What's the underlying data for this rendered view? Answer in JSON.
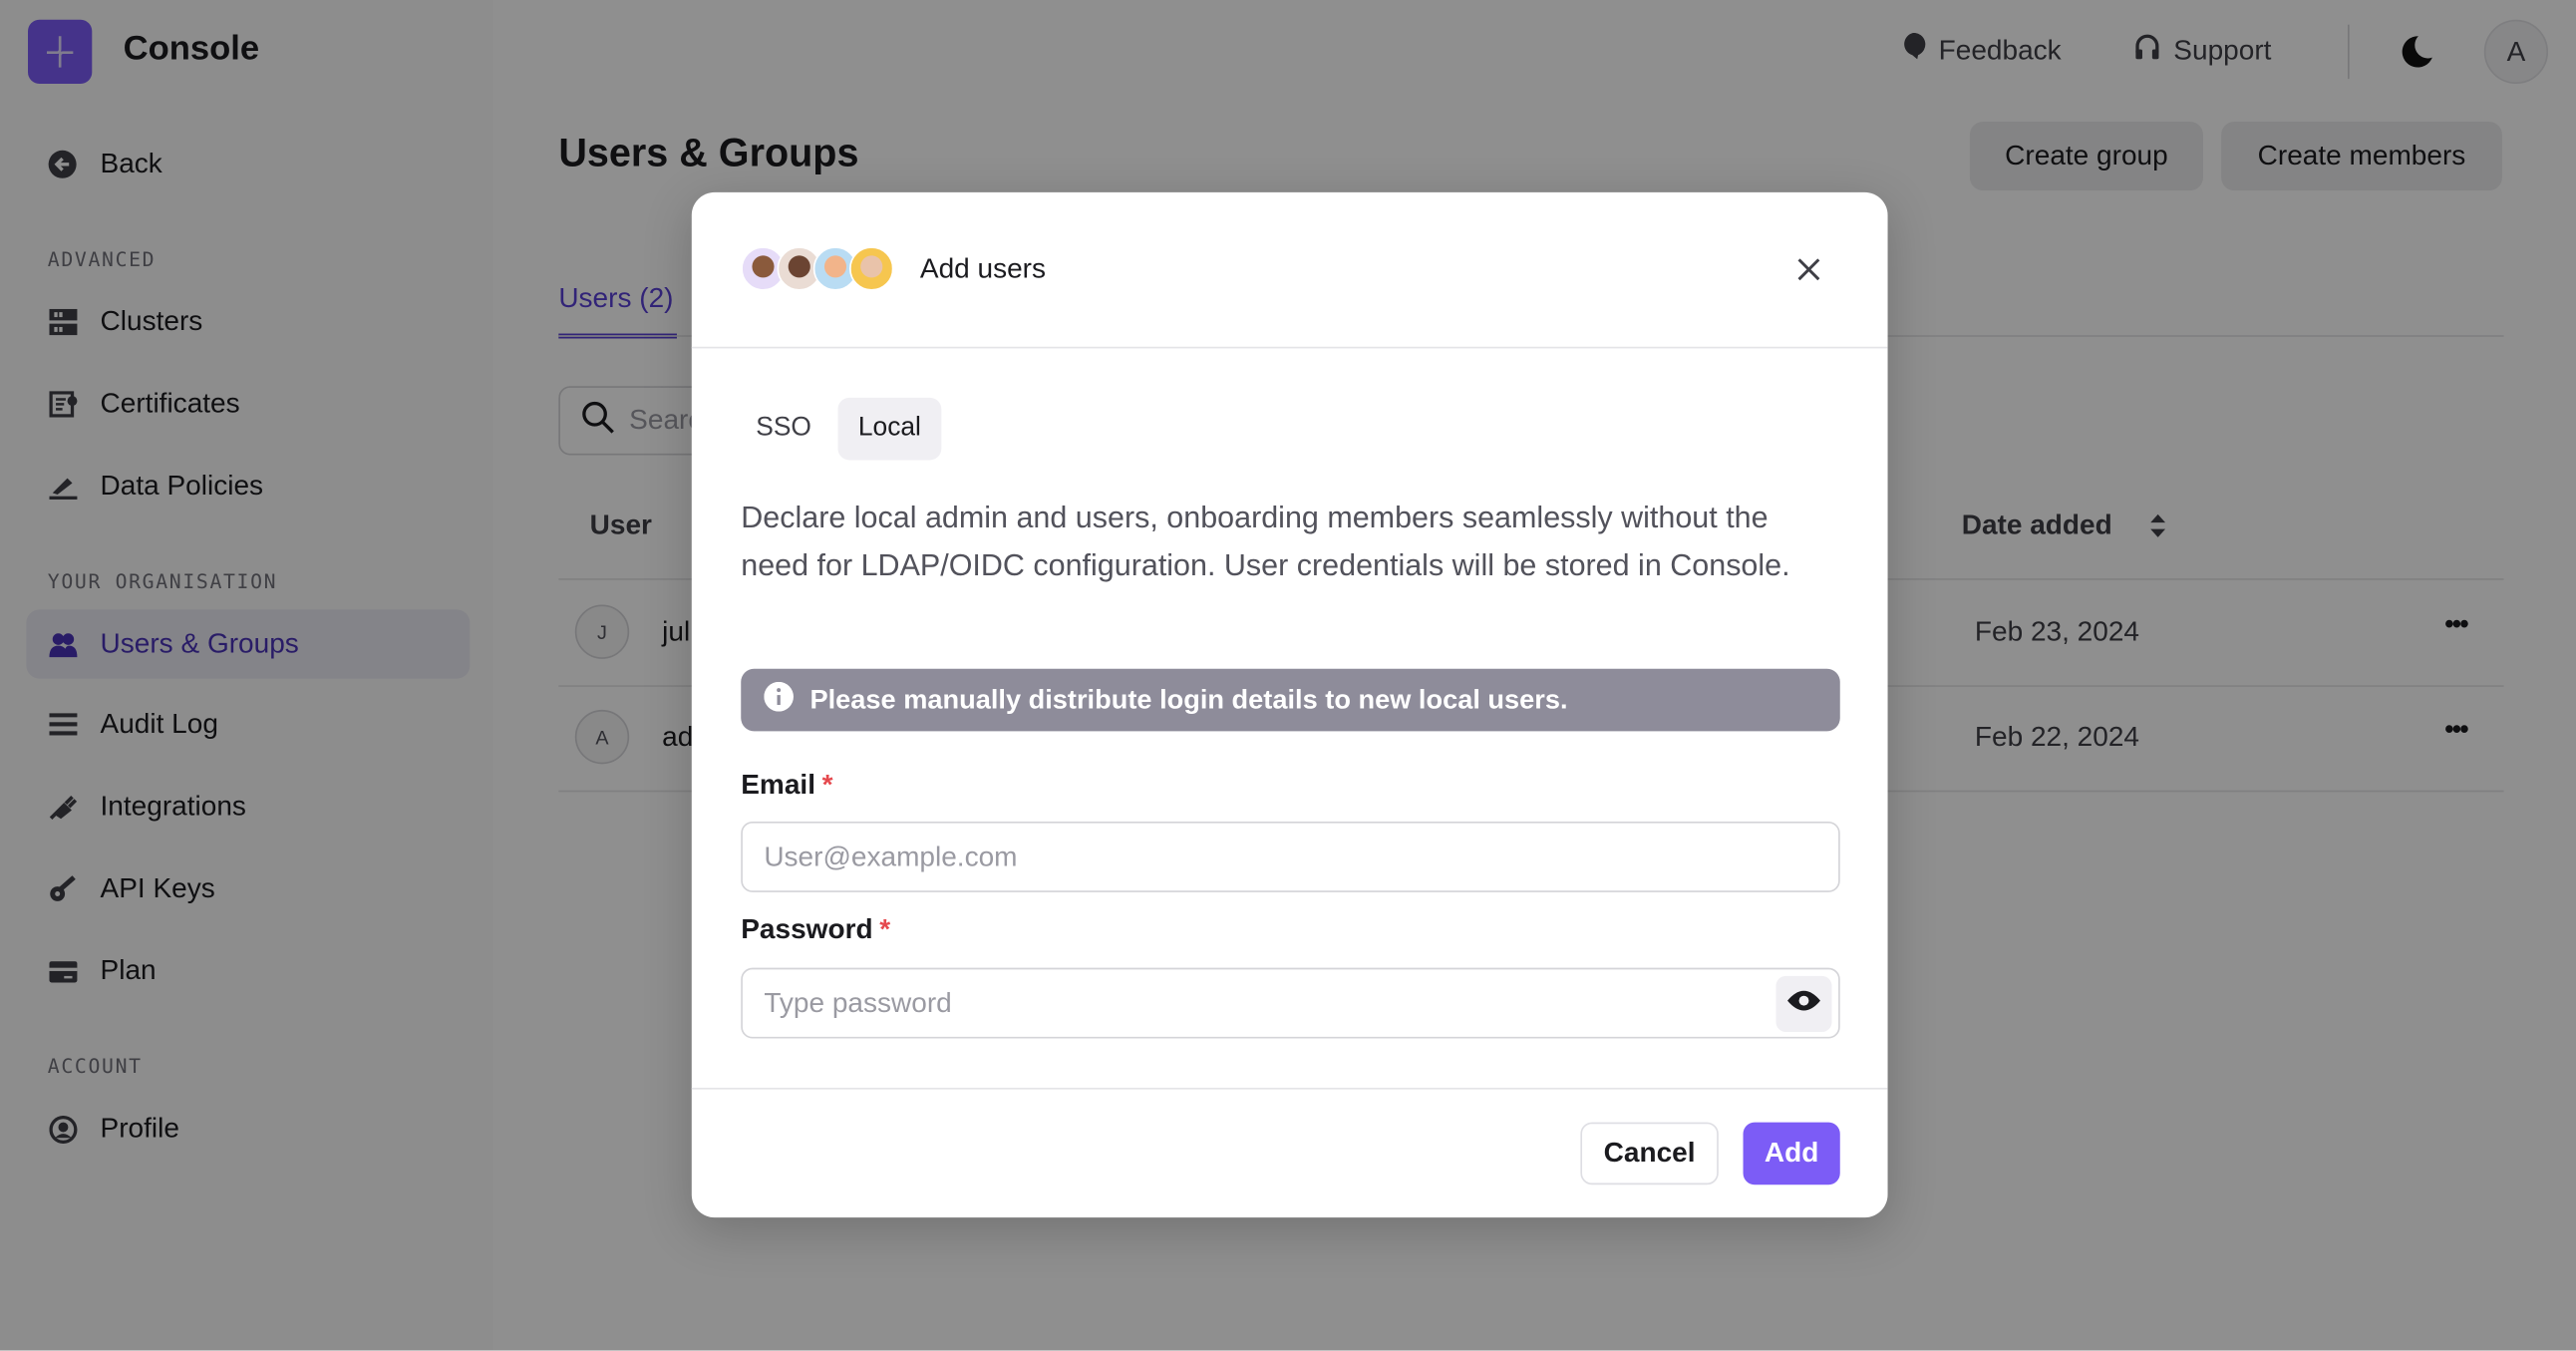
{
  "app": {
    "title": "Console"
  },
  "header": {
    "feedback": "Feedback",
    "support": "Support",
    "avatar_initial": "A"
  },
  "sidebar": {
    "back": "Back",
    "sections": [
      {
        "title": "ADVANCED",
        "items": [
          {
            "label": "Clusters",
            "icon": "server-icon"
          },
          {
            "label": "Certificates",
            "icon": "certificate-icon"
          },
          {
            "label": "Data Policies",
            "icon": "pen-icon"
          }
        ]
      },
      {
        "title": "YOUR ORGANISATION",
        "items": [
          {
            "label": "Users & Groups",
            "icon": "users-icon",
            "active": true
          },
          {
            "label": "Audit Log",
            "icon": "list-icon"
          },
          {
            "label": "Integrations",
            "icon": "plug-icon"
          },
          {
            "label": "API Keys",
            "icon": "key-icon"
          },
          {
            "label": "Plan",
            "icon": "credit-card-icon"
          }
        ]
      },
      {
        "title": "ACCOUNT",
        "items": [
          {
            "label": "Profile",
            "icon": "user-circle-icon"
          }
        ]
      }
    ]
  },
  "main": {
    "title": "Users & Groups",
    "create_group": "Create group",
    "create_members": "Create members",
    "tab_users": "Users (2)",
    "search_placeholder": "Search",
    "col_user": "User",
    "col_date": "Date added",
    "rows": [
      {
        "initial": "J",
        "name": "jul",
        "date": "Feb 23, 2024"
      },
      {
        "initial": "A",
        "name": "ad",
        "date": "Feb 22, 2024"
      }
    ]
  },
  "modal": {
    "title": "Add users",
    "tabs": [
      "SSO",
      "Local"
    ],
    "active_tab": "Local",
    "description": "Declare local admin and users, onboarding members seamlessly without the need for LDAP/OIDC configuration. User credentials will be stored in Console.",
    "notice": "Please manually distribute login details to new local users.",
    "email_label": "Email",
    "email_placeholder": "User@example.com",
    "password_label": "Password",
    "password_placeholder": "Type password",
    "required_mark": "*",
    "cancel": "Cancel",
    "add": "Add"
  },
  "colors": {
    "accent": "#7c5cf6",
    "notice_bg": "#8e8c9a"
  }
}
